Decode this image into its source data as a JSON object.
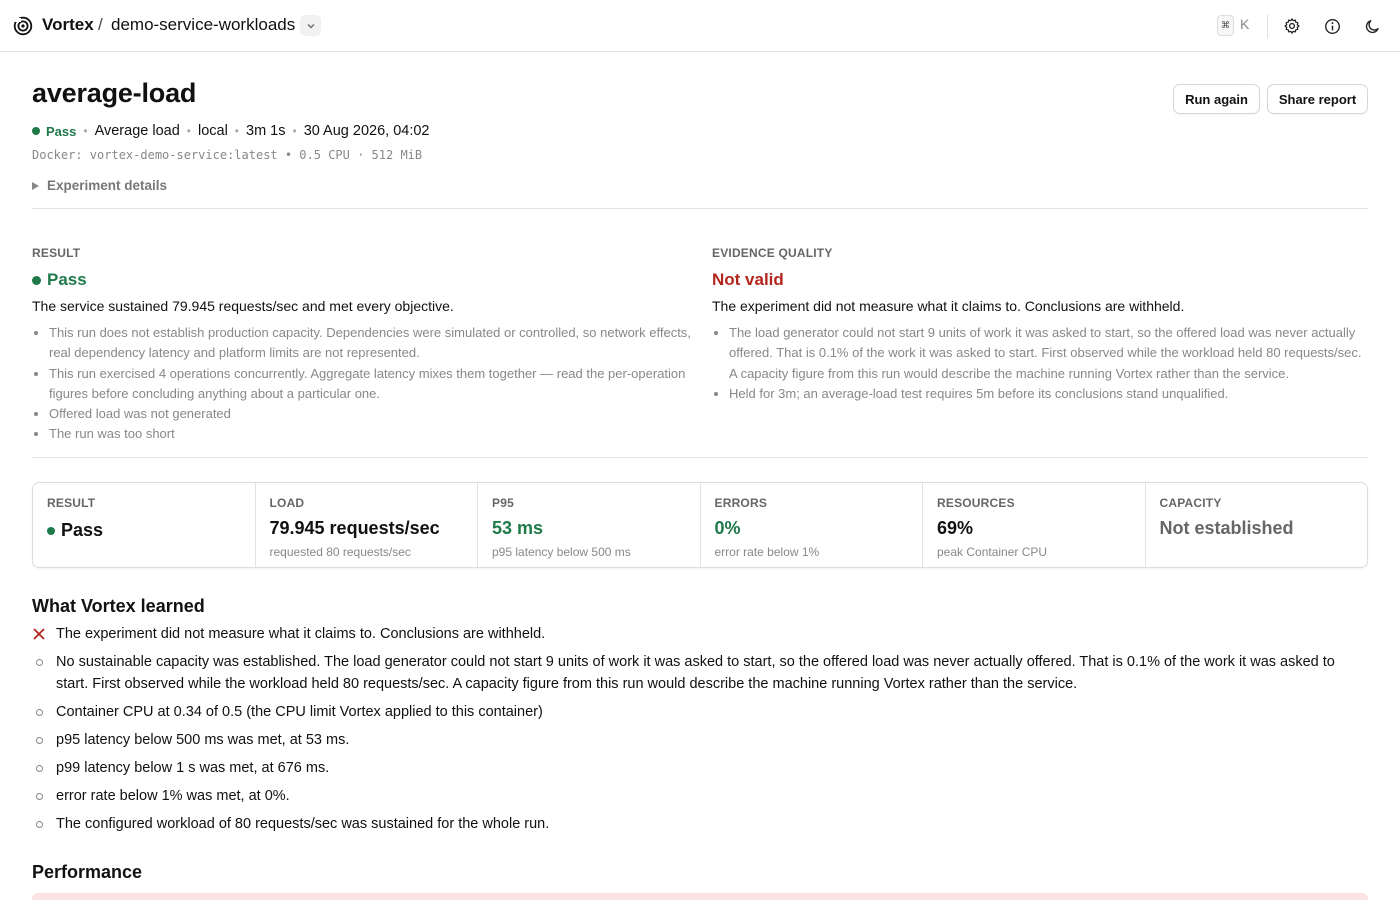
{
  "topbar": {
    "brand": "Vortex",
    "separator": "/",
    "project": "demo-service-workloads",
    "kbd_cmd": "⌘",
    "kbd_key": "K",
    "icons": [
      "vortex-logo-icon",
      "chevron-down-icon",
      "gear-icon",
      "info-icon",
      "moon-icon"
    ]
  },
  "header": {
    "title": "average-load",
    "run_again": "Run again",
    "share_report": "Share report",
    "status": "Pass",
    "workload": "Average load",
    "env": "local",
    "duration": "3m 1s",
    "timestamp": "30 Aug 2026, 04:02",
    "docker": "Docker: vortex-demo-service:latest • 0.5 CPU · 512 MiB",
    "details_label": "Experiment details"
  },
  "result": {
    "label": "RESULT",
    "status": "Pass",
    "summary": "The service sustained 79.945 requests/sec and met every objective.",
    "bullets": [
      "This run does not establish production capacity. Dependencies were simulated or controlled, so network effects, real dependency latency and platform limits are not represented.",
      "This run exercised 4 operations concurrently. Aggregate latency mixes them together — read the per-operation figures before concluding anything about a particular one.",
      "Offered load was not generated",
      "The run was too short"
    ]
  },
  "evidence": {
    "label": "EVIDENCE QUALITY",
    "status": "Not valid",
    "summary": "The experiment did not measure what it claims to. Conclusions are withheld.",
    "bullets": [
      "The load generator could not start 9 units of work it was asked to start, so the offered load was never actually offered. That is 0.1% of the work it was asked to start. First observed while the workload held 80 requests/sec. A capacity figure from this run would describe the machine running Vortex rather than the service.",
      "Held for 3m; an average-load test requires 5m before its conclusions stand unqualified."
    ]
  },
  "cards": [
    {
      "label": "RESULT",
      "value": "Pass",
      "sub": ""
    },
    {
      "label": "LOAD",
      "value": "79.945 requests/sec",
      "sub": "requested 80 requests/sec"
    },
    {
      "label": "P95",
      "value": "53 ms",
      "sub": "p95 latency below 500 ms"
    },
    {
      "label": "ERRORS",
      "value": "0%",
      "sub": "error rate below 1%"
    },
    {
      "label": "RESOURCES",
      "value": "69%",
      "sub": "peak Container CPU"
    },
    {
      "label": "CAPACITY",
      "value": "Not established",
      "sub": ""
    }
  ],
  "learned": {
    "title": "What Vortex learned",
    "items": [
      "The experiment did not measure what it claims to. Conclusions are withheld.",
      "No sustainable capacity was established. The load generator could not start 9 units of work it was asked to start, so the offered load was never actually offered. That is 0.1% of the work it was asked to start. First observed while the workload held 80 requests/sec. A capacity figure from this run would describe the machine running Vortex rather than the service.",
      "Container CPU at 0.34 of 0.5 (the CPU limit Vortex applied to this container)",
      "p95 latency below 500 ms was met, at 53 ms.",
      "p99 latency below 1 s was met, at 676 ms.",
      "error rate below 1% was met, at 0%.",
      "The configured workload of 80 requests/sec was sustained for the whole run."
    ]
  },
  "performance": {
    "title": "Performance"
  },
  "colors": {
    "pass": "#1f7a4a",
    "invalid": "#b3261e",
    "alert_bg": "#fbe3e1"
  }
}
